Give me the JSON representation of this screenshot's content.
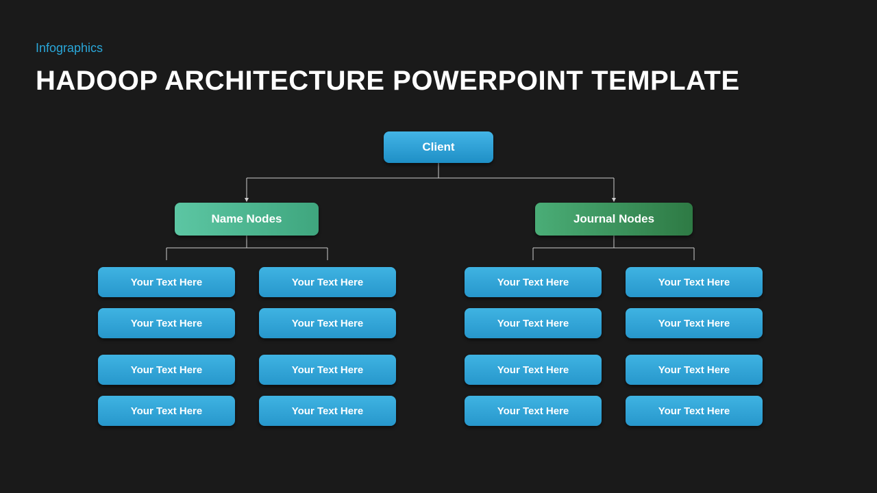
{
  "header": {
    "subtitle": "Infographics",
    "title": "HADOOP ARCHITECTURE POWERPOINT TEMPLATE"
  },
  "tree": {
    "root": {
      "label": "Client"
    },
    "branches": [
      {
        "label": "Name Nodes",
        "children": [
          [
            "Your Text Here",
            "Your Text Here"
          ],
          [
            "Your Text Here",
            "Your Text Here"
          ],
          [
            "Your Text Here",
            "Your Text Here"
          ],
          [
            "Your Text Here",
            "Your Text Here"
          ]
        ]
      },
      {
        "label": "Journal Nodes",
        "children": [
          [
            "Your Text Here",
            "Your Text Here"
          ],
          [
            "Your Text Here",
            "Your Text Here"
          ],
          [
            "Your Text Here",
            "Your Text Here"
          ],
          [
            "Your Text Here",
            "Your Text Here"
          ]
        ]
      }
    ]
  },
  "colors": {
    "accent": "#2aa7d9",
    "background": "#1a1a1a",
    "leaf": "#2797cc",
    "branch1": "#4cb993",
    "branch2": "#3a8f55"
  }
}
